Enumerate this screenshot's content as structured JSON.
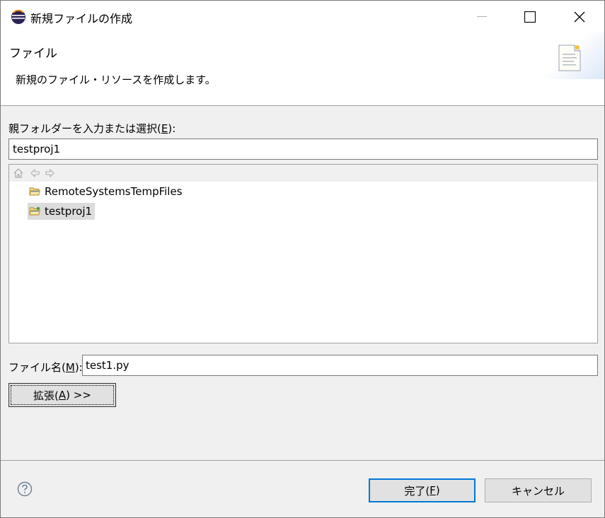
{
  "window": {
    "title": "新規ファイルの作成"
  },
  "header": {
    "title": "ファイル",
    "description": "新規のファイル・リソースを作成します。"
  },
  "folder": {
    "label_prefix": "親フォルダーを入力または選択(",
    "label_mnemonic": "E",
    "label_suffix": "):",
    "value": "testproj1"
  },
  "tree": {
    "toolbar_icons": [
      "home-icon",
      "back-arrow-icon",
      "forward-arrow-icon"
    ],
    "items": [
      {
        "label": "RemoteSystemsTempFiles",
        "icon": "folder-open-icon",
        "selected": false
      },
      {
        "label": "testproj1",
        "icon": "project-folder-icon",
        "selected": true
      }
    ]
  },
  "filename": {
    "label_prefix": "ファイル名(",
    "label_mnemonic": "M",
    "label_suffix": "):",
    "value": "test1.py"
  },
  "advanced": {
    "label_prefix": "拡張(",
    "label_mnemonic": "A",
    "label_suffix": ") >>"
  },
  "footer": {
    "finish_prefix": "完了(",
    "finish_mnemonic": "F",
    "finish_suffix": ")",
    "cancel_label": "キャンセル"
  },
  "colors": {
    "accent": "#0078d7",
    "selection": "#dcdcdc"
  }
}
